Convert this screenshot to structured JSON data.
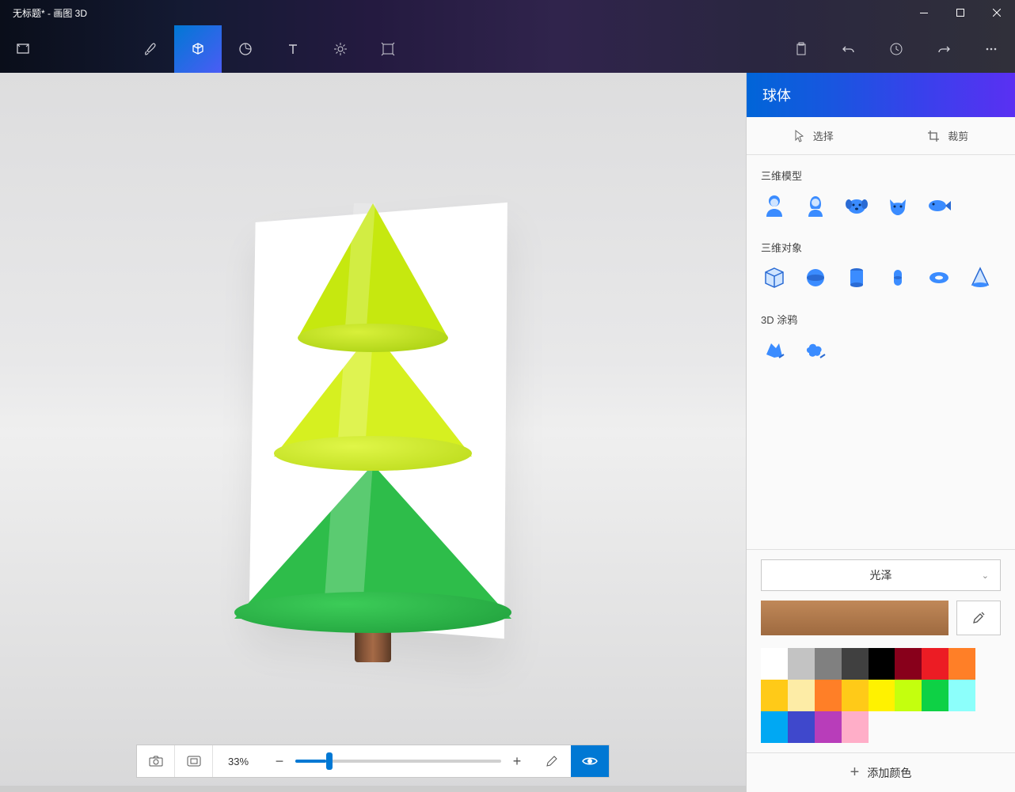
{
  "window": {
    "title": "无标题* - 画图 3D"
  },
  "panel": {
    "title": "球体",
    "select": "选择",
    "crop": "裁剪",
    "sections": {
      "models": "三维模型",
      "objects": "三维对象",
      "doodle": "3D 涂鸦"
    },
    "material": {
      "label": "光泽",
      "current_color": "#b27c4e"
    },
    "add_color": "添加颜色"
  },
  "status": {
    "zoom_label": "33%",
    "zoom_percent": 33
  },
  "palette": [
    "#ffffff",
    "#c3c3c3",
    "#808080",
    "#404040",
    "#000000",
    "#88001b",
    "#ec1c24",
    "#ff7f27",
    "#ffca18",
    "#fdeca6",
    "#ff7f27",
    "#ffca18",
    "#fff200",
    "#c4ff0e",
    "#0ed145",
    "#8cfffb",
    "#00a8f3",
    "#3f48cc",
    "#b83dba",
    "#ffaec8"
  ]
}
